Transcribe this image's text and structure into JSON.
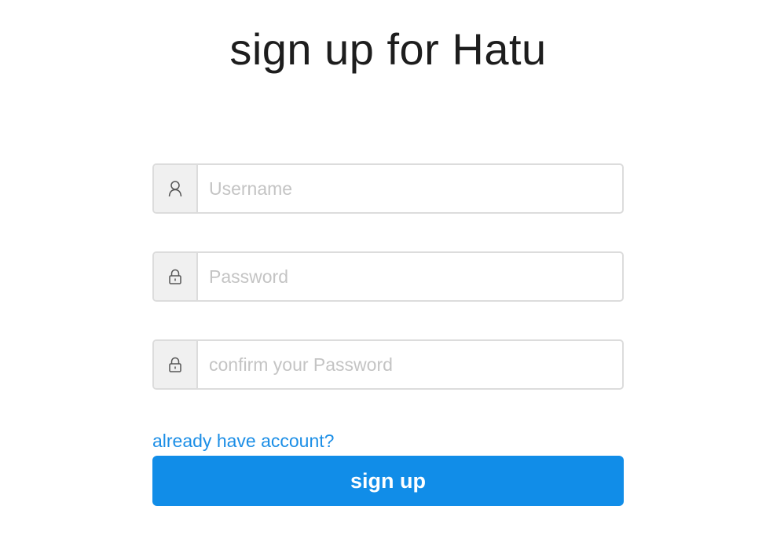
{
  "page": {
    "title": "sign up for Hatu"
  },
  "form": {
    "username": {
      "icon": "user-icon",
      "placeholder": "Username",
      "value": ""
    },
    "password": {
      "icon": "lock-icon",
      "placeholder": "Password",
      "value": ""
    },
    "confirm_password": {
      "icon": "lock-icon",
      "placeholder": "confirm your Password",
      "value": ""
    },
    "login_link_label": "already have account?",
    "submit_label": "sign up"
  },
  "colors": {
    "accent": "#118de8",
    "link": "#1b8ee6",
    "border": "#dcdcdc",
    "addon_bg": "#f0f0f0",
    "placeholder": "#c4c4c4"
  }
}
